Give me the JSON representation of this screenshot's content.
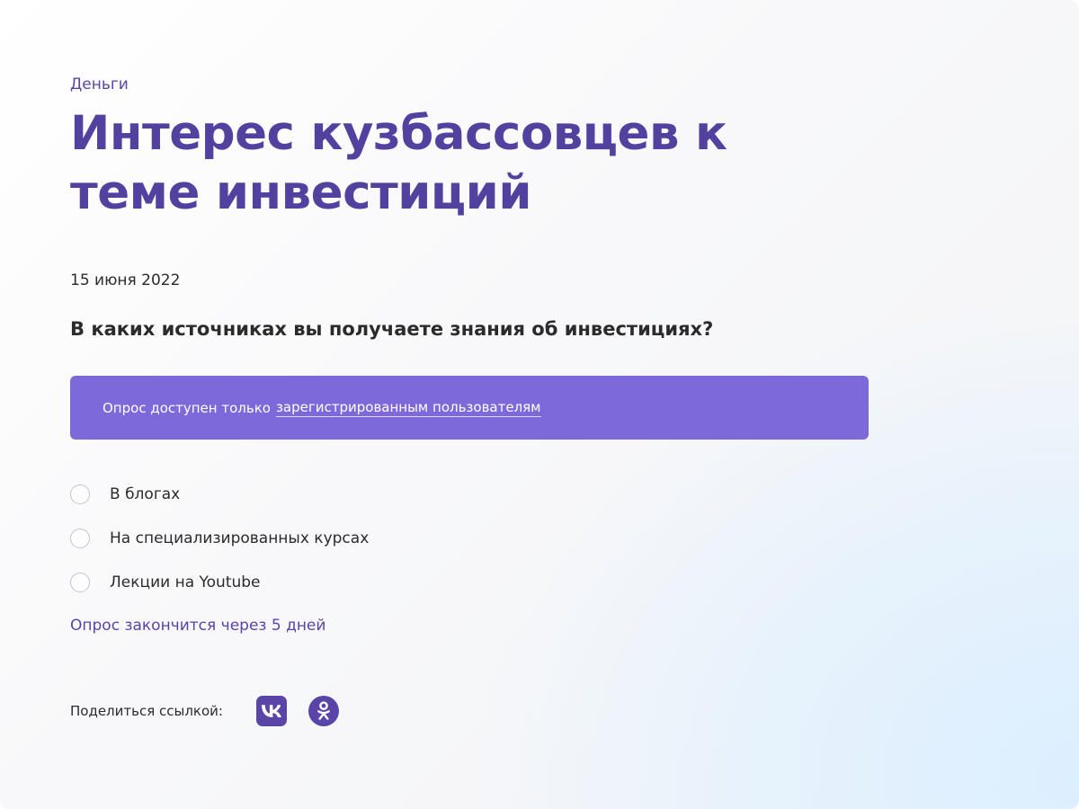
{
  "article": {
    "category": "Деньги",
    "title": "Интерес кузбассовцев к теме инвестиций",
    "date": "15 июня 2022"
  },
  "poll": {
    "question": "В каких источниках вы получаете знания об инвестициях?",
    "notice_text": "Опрос доступен только",
    "notice_link": "зарегистрированным пользователям",
    "options": [
      {
        "label": "В блогах"
      },
      {
        "label": "На специализированных курсах"
      },
      {
        "label": "Лекции на Youtube"
      }
    ],
    "ends_text": "Опрос закончится через 5 дней"
  },
  "share": {
    "label": "Поделиться ссылкой:",
    "buttons": [
      {
        "icon": "vk-icon"
      },
      {
        "icon": "odnoklassniki-icon"
      }
    ]
  },
  "colors": {
    "accent": "#53419f",
    "notice_bg": "#7e69db",
    "text": "#2b2b2b"
  }
}
